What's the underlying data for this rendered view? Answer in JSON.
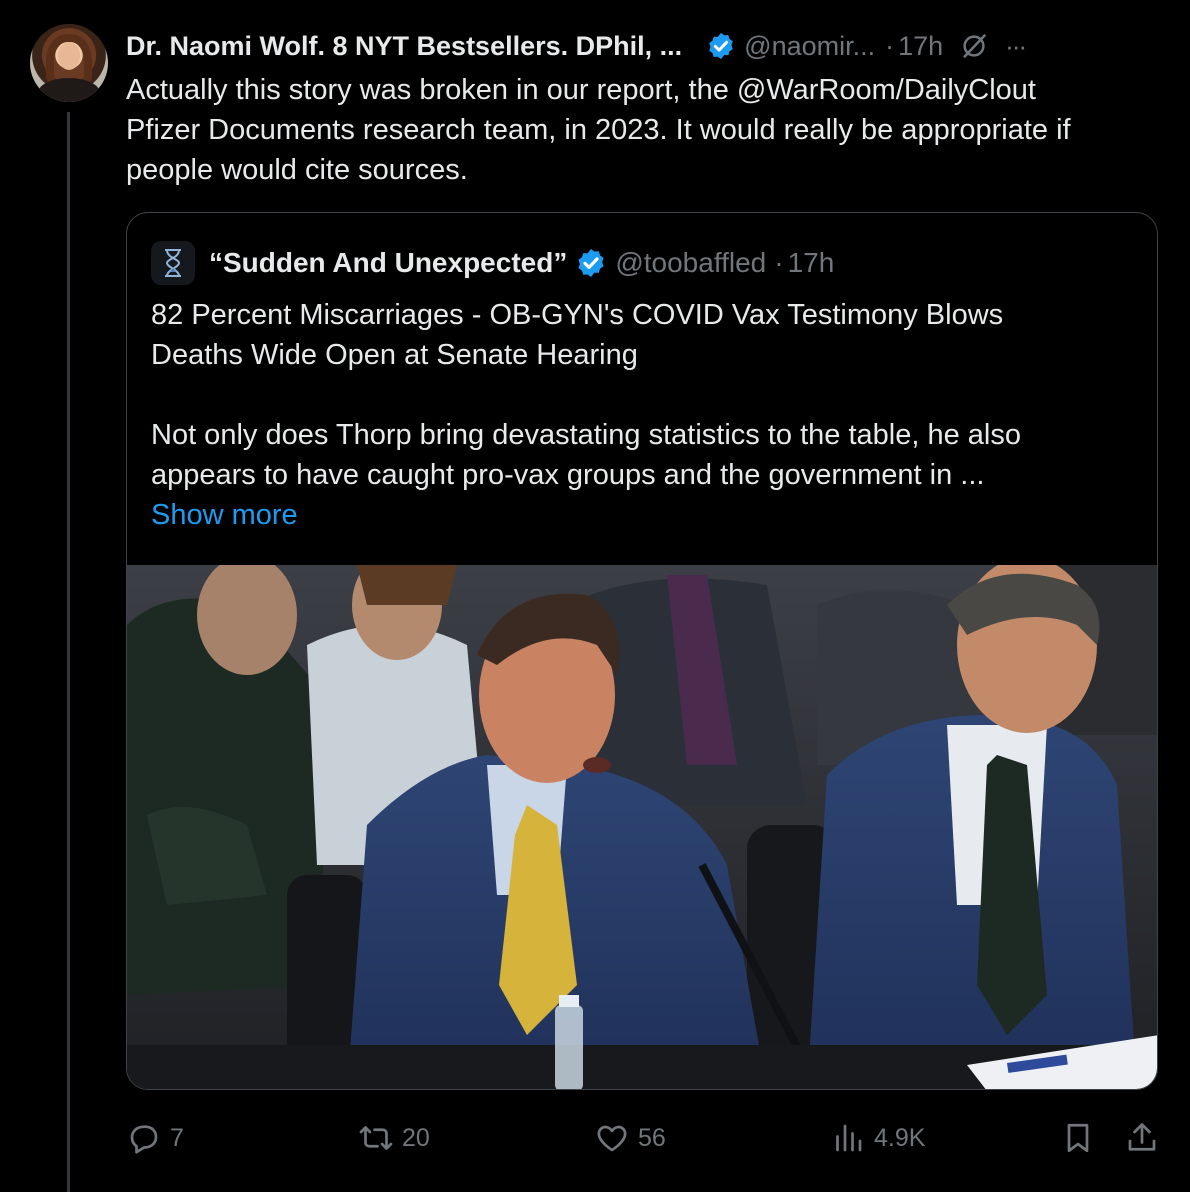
{
  "tweet": {
    "author_name": "Dr. Naomi Wolf. 8 NYT Bestsellers. DPhil, ...",
    "handle": "@naomir...",
    "dot": "·",
    "time": "17h",
    "more": "···",
    "text_lines": [
      "Actually this story was broken in our report, the @WarRoom/DailyClout",
      "Pfizer Documents research team, in 2023. It would really be appropriate if",
      "people would cite sources."
    ]
  },
  "quote": {
    "author_name": "“Sudden And Unexpected”",
    "handle": "@toobaffled",
    "dot": "·",
    "time": "17h",
    "lines": [
      "82 Percent Miscarriages - OB-GYN's COVID Vax Testimony Blows",
      "Deaths Wide Open at Senate Hearing",
      "",
      "Not only does Thorp bring devastating statistics to the table, he also",
      "appears to have caught pro-vax groups and the government in ..."
    ],
    "show_more": "Show more"
  },
  "actions": {
    "replies": "7",
    "reposts": "20",
    "likes": "56",
    "views": "4.9K"
  },
  "colors": {
    "accent": "#1d9bf0",
    "muted": "#71767b",
    "text": "#e7e9ea",
    "background": "#000000"
  },
  "icons": [
    "verified-icon",
    "grok-icon",
    "more-icon",
    "reply-icon",
    "repost-icon",
    "like-icon",
    "views-icon",
    "bookmark-icon",
    "share-icon"
  ]
}
